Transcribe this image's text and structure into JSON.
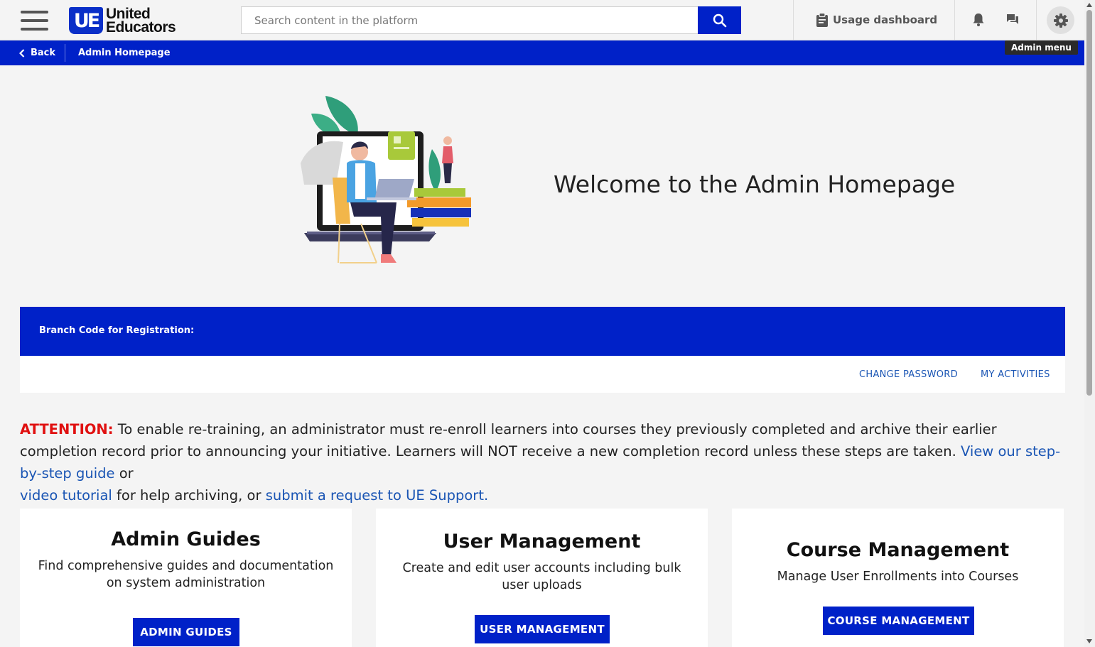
{
  "header": {
    "logo_mark": "UE",
    "logo_line1": "United",
    "logo_line2": "Educators",
    "search_placeholder": "Search content in the platform",
    "usage_label": "Usage dashboard",
    "admin_menu_tooltip": "Admin menu"
  },
  "nav": {
    "back_label": "Back",
    "breadcrumb": "Admin Homepage"
  },
  "hero": {
    "title": "Welcome to the Admin Homepage"
  },
  "branch": {
    "label": "Branch Code for Registration:"
  },
  "links": {
    "change_password": "CHANGE PASSWORD",
    "my_activities": "MY ACTIVITIES"
  },
  "attention": {
    "label": "ATTENTION:",
    "text1": " To enable re-training, an administrator must re-enroll learners into courses they previously completed and archive their earlier completion record prior to announcing your initiative. Learners will NOT receive a new completion record unless these steps are taken. ",
    "link1": "View our step-by-step guide",
    "text2": " or ",
    "link2": "video tutorial ",
    "text3": "for help archiving, or ",
    "link3": "submit a request to UE Support."
  },
  "cards": [
    {
      "title": "Admin Guides",
      "description": "Find comprehensive guides and documentation on system administration",
      "button": "ADMIN GUIDES"
    },
    {
      "title": "User Management",
      "description": "Create and edit user accounts including bulk user uploads",
      "button": "USER MANAGEMENT"
    },
    {
      "title": "Course Management",
      "description": "Manage User Enrollments into Courses",
      "button": "COURSE MANAGEMENT"
    }
  ],
  "colors": {
    "brand_blue": "#0021c8",
    "link_blue": "#1a55b4",
    "attention_red": "#e01010"
  },
  "icons": [
    "hamburger-icon",
    "search-icon",
    "clipboard-icon",
    "bell-icon",
    "chat-icon",
    "gear-icon",
    "chevron-left-icon"
  ]
}
